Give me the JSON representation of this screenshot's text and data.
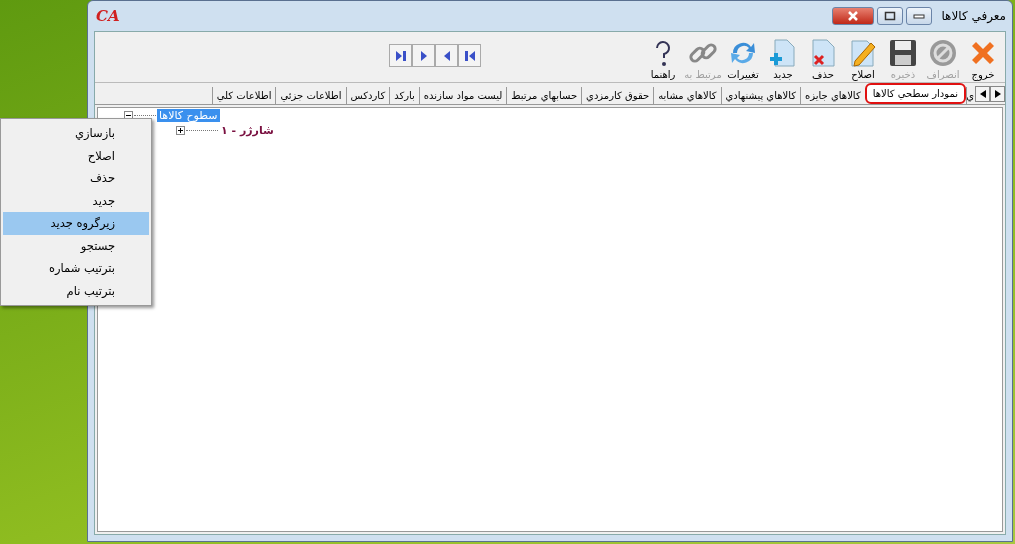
{
  "window": {
    "logo": "CA",
    "title": "معرفي کالاها"
  },
  "toolbar": [
    {
      "kind": "exit",
      "label": "خروج",
      "disabled": false
    },
    {
      "kind": "cancel",
      "label": "انصراف",
      "disabled": true
    },
    {
      "kind": "save",
      "label": "ذخيره",
      "disabled": true
    },
    {
      "kind": "edit",
      "label": "اصلاح",
      "disabled": false
    },
    {
      "kind": "delete",
      "label": "حذف",
      "disabled": false
    },
    {
      "kind": "new",
      "label": "جديد",
      "disabled": false
    },
    {
      "kind": "refresh",
      "label": "تغييرات",
      "disabled": false
    },
    {
      "kind": "link",
      "label": "مرتبط به",
      "disabled": true
    },
    {
      "kind": "help",
      "label": "راهنما",
      "disabled": false
    }
  ],
  "tabs": [
    {
      "label": "ي",
      "selected": false
    },
    {
      "label": "نمودار سطحي کالاها",
      "selected": true
    },
    {
      "label": "کالاهاي جايزه",
      "selected": false
    },
    {
      "label": "کالاهاي پيشنهادي",
      "selected": false
    },
    {
      "label": "کالاهاي مشابه",
      "selected": false
    },
    {
      "label": "حقوق کارمزدي",
      "selected": false
    },
    {
      "label": "حسابهاي مرتبط",
      "selected": false
    },
    {
      "label": "ليست مواد سازنده",
      "selected": false
    },
    {
      "label": "بارکد",
      "selected": false
    },
    {
      "label": "کاردکس",
      "selected": false
    },
    {
      "label": "اطلاعات جزئي",
      "selected": false
    },
    {
      "label": "اطلاعات کلي",
      "selected": false
    }
  ],
  "tree": [
    {
      "label": "سطوح کالاها",
      "selected": true,
      "expanded": true,
      "children": [
        {
          "label": "شارژر - ۱",
          "selected": false,
          "expanded": false
        }
      ]
    }
  ],
  "context_menu": [
    {
      "label": "بازسازي",
      "selected": false
    },
    {
      "label": "اصلاح",
      "selected": false
    },
    {
      "label": "حذف",
      "selected": false
    },
    {
      "label": "جديد",
      "selected": false
    },
    {
      "label": "زيرگروه جديد",
      "selected": true
    },
    {
      "label": "جستجو",
      "selected": false
    },
    {
      "label": "بترتيب شماره",
      "selected": false
    },
    {
      "label": "بترتيب نام",
      "selected": false
    }
  ]
}
